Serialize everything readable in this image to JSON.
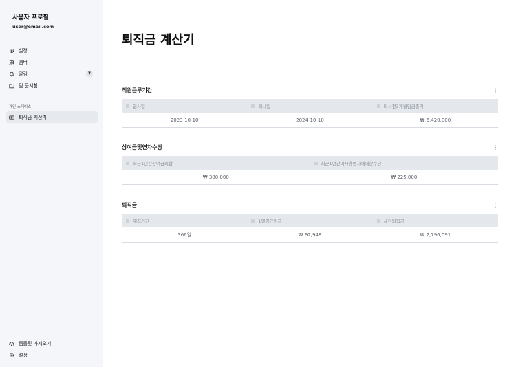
{
  "sidebar": {
    "profile_name": "사용자 프로필",
    "profile_email": "user@email.com",
    "more_label": "...",
    "nav": [
      {
        "label": "설정",
        "icon": "gear-icon"
      },
      {
        "label": "멤버",
        "icon": "users-icon"
      },
      {
        "label": "알림",
        "icon": "bell-icon",
        "badge": "7"
      },
      {
        "label": "팀 문서함",
        "icon": "folder-icon"
      }
    ],
    "section_label": "개인 스페이스",
    "space_items": [
      {
        "label": "퇴직금 계산기",
        "icon": "calculator-icon",
        "active": true
      }
    ],
    "bottom": [
      {
        "label": "템플릿 가져오기",
        "icon": "cloud-download-icon"
      },
      {
        "label": "설정",
        "icon": "gear-icon"
      }
    ]
  },
  "main": {
    "title": "퇴직금 계산기",
    "blocks": [
      {
        "title": "직원근무기간",
        "columns": [
          "입사일",
          "퇴사일",
          "퇴사전3개월임금총액"
        ],
        "values": [
          "2023-10-10",
          "2024-10-10",
          "₩ 6,420,000"
        ]
      },
      {
        "title": "상여금및연차수당",
        "columns": [
          "최근1년간상여금의합",
          "최근1년간미사용연차에대한수당"
        ],
        "values": [
          "₩ 300,000",
          "₩ 225,000"
        ]
      },
      {
        "title": "퇴직금",
        "columns": [
          "재직기간",
          "1일평균임금",
          "세전퇴직금"
        ],
        "values": [
          "366일",
          "₩ 92,948",
          "₩ 2,796,091"
        ]
      }
    ]
  }
}
